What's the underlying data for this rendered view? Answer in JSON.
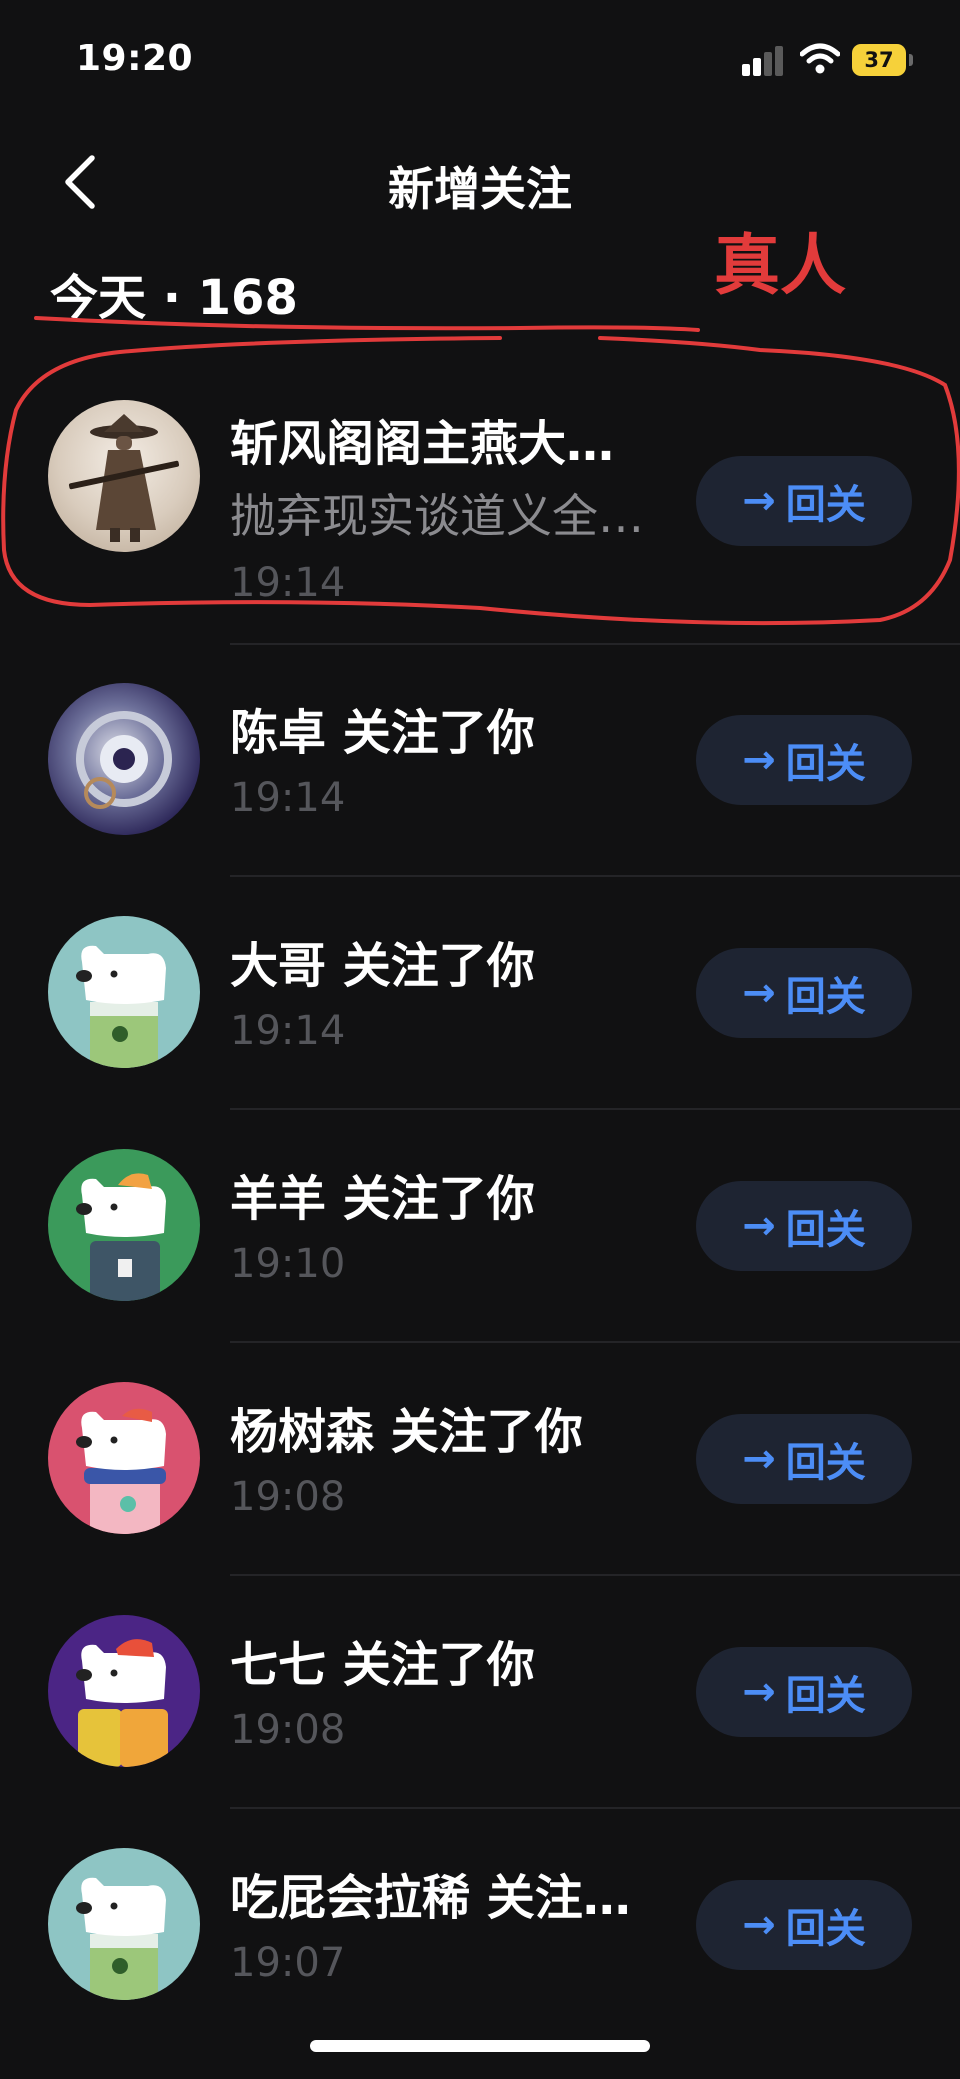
{
  "status_bar": {
    "time": "19:20",
    "battery": "37"
  },
  "nav": {
    "title": "新增关注"
  },
  "section": {
    "header": "今天 · 168"
  },
  "annotation": {
    "label": "真人",
    "color": "#e23b3b"
  },
  "colors": {
    "accent": "#4c8df6",
    "button_bg": "#1e2432",
    "background": "#111112"
  },
  "follow_button": {
    "icon": "arrow-right-icon",
    "label": "回关"
  },
  "items": [
    {
      "name": "斩风阁阁主燕大…",
      "subtitle": "抛弃现实谈道义全…",
      "time": "19:14",
      "avatar": "swordsman-avatar",
      "button": "回关"
    },
    {
      "name": "陈卓 关注了你",
      "time": "19:14",
      "avatar": "mechanical-eye-avatar",
      "button": "回关"
    },
    {
      "name": "大哥 关注了你",
      "time": "19:14",
      "avatar": "bear-avatar-teal",
      "button": "回关"
    },
    {
      "name": "羊羊 关注了你",
      "time": "19:10",
      "avatar": "bear-avatar-green",
      "button": "回关"
    },
    {
      "name": "杨树森 关注了你",
      "time": "19:08",
      "avatar": "bear-avatar-pink",
      "button": "回关"
    },
    {
      "name": "七七 关注了你",
      "time": "19:08",
      "avatar": "bear-avatar-purple",
      "button": "回关"
    },
    {
      "name": "吃屁会拉稀 关注…",
      "time": "19:07",
      "avatar": "bear-avatar-teal",
      "button": "回关"
    }
  ]
}
